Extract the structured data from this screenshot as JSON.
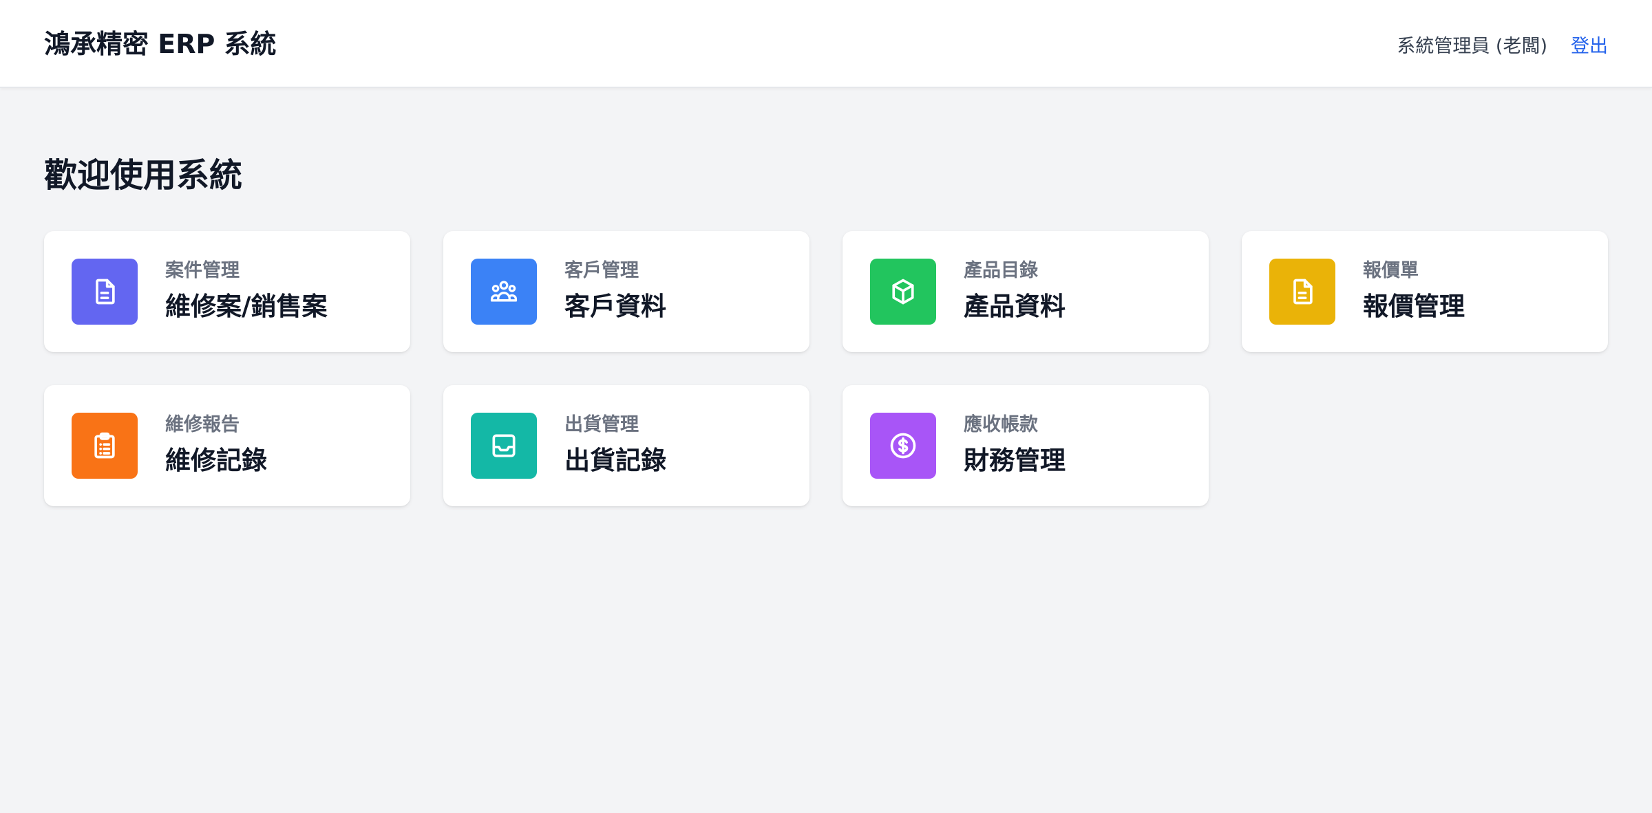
{
  "header": {
    "title": "鴻承精密 ERP 系統",
    "user": "系統管理員 (老闆)",
    "logout_label": "登出"
  },
  "main": {
    "welcome": "歡迎使用系統",
    "cards": [
      {
        "sub": "案件管理",
        "label": "維修案/銷售案",
        "icon": "document-icon",
        "color": "#6366f1"
      },
      {
        "sub": "客戶管理",
        "label": "客戶資料",
        "icon": "users-icon",
        "color": "#3b82f6"
      },
      {
        "sub": "產品目錄",
        "label": "產品資料",
        "icon": "cube-icon",
        "color": "#22c55e"
      },
      {
        "sub": "報價單",
        "label": "報價管理",
        "icon": "document-icon",
        "color": "#eab308"
      },
      {
        "sub": "維修報告",
        "label": "維修記錄",
        "icon": "clipboard-list-icon",
        "color": "#f97316"
      },
      {
        "sub": "出貨管理",
        "label": "出貨記錄",
        "icon": "inbox-icon",
        "color": "#14b8a6"
      },
      {
        "sub": "應收帳款",
        "label": "財務管理",
        "icon": "dollar-circle-icon",
        "color": "#a855f7"
      }
    ]
  }
}
